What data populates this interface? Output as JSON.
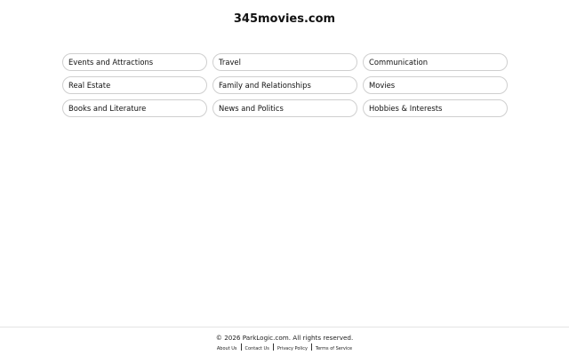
{
  "header": {
    "site_title": "345movies.com"
  },
  "links": [
    {
      "label": "Events and Attractions"
    },
    {
      "label": "Travel"
    },
    {
      "label": "Communication"
    },
    {
      "label": "Real Estate"
    },
    {
      "label": "Family and Relationships"
    },
    {
      "label": "Movies"
    },
    {
      "label": "Books and Literature"
    },
    {
      "label": "News and Politics"
    },
    {
      "label": "Hobbies & Interests"
    }
  ],
  "footer": {
    "copyright": "© 2026 ParkLogic.com. All rights reserved.",
    "links": [
      {
        "label": "About Us"
      },
      {
        "label": "Contact Us"
      },
      {
        "label": "Privacy Policy"
      },
      {
        "label": "Terms of Service"
      }
    ]
  }
}
